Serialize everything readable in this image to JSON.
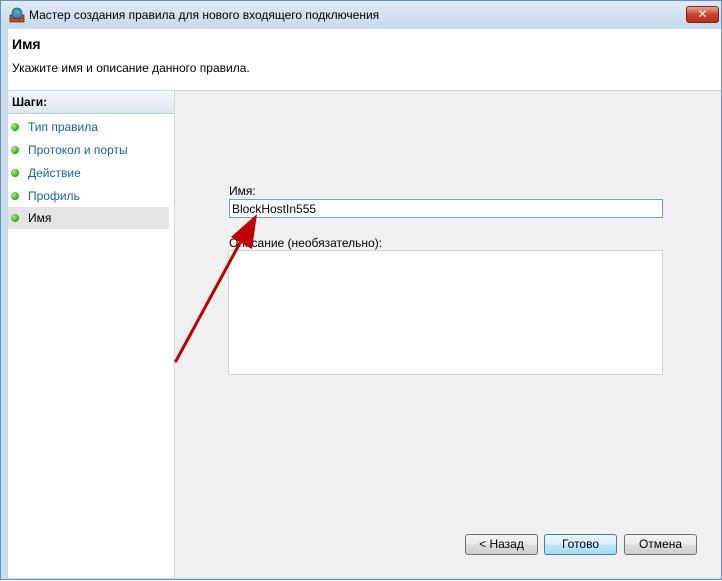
{
  "window": {
    "title": "Мастер создания правила для нового входящего подключения",
    "close_label": "✕"
  },
  "header": {
    "title": "Имя",
    "description": "Укажите имя и описание данного правила."
  },
  "sidebar": {
    "heading": "Шаги:",
    "items": [
      {
        "label": "Тип правила",
        "active": false
      },
      {
        "label": "Протокол и порты",
        "active": false
      },
      {
        "label": "Действие",
        "active": false
      },
      {
        "label": "Профиль",
        "active": false
      },
      {
        "label": "Имя",
        "active": true
      }
    ]
  },
  "form": {
    "name_label": "Имя:",
    "name_value": "BlockHostIn555",
    "description_label": "Описание (необязательно):",
    "description_value": ""
  },
  "buttons": {
    "back": "< Назад",
    "finish": "Готово",
    "cancel": "Отмена"
  },
  "colors": {
    "annotation_arrow": "#c00000"
  }
}
